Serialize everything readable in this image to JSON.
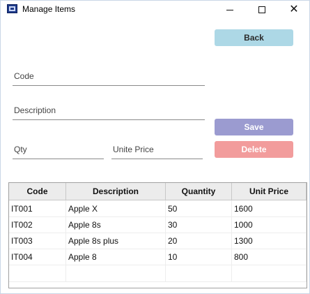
{
  "window": {
    "title": "Manage Items",
    "app_icon": "app-icon",
    "controls": {
      "minimize": "minimize-icon",
      "maximize": "maximize-icon",
      "close": "✕"
    }
  },
  "buttons": {
    "back": "Back",
    "save": "Save",
    "delete": "Delete"
  },
  "form": {
    "code_label": "Code",
    "description_label": "Description",
    "qty_label": "Qty",
    "unit_price_label": "Unite Price"
  },
  "colors": {
    "back_button": "#add8e6",
    "save_button": "#9b9bd0",
    "delete_button": "#f29c9c"
  },
  "table": {
    "columns": [
      "Code",
      "Description",
      "Quantity",
      "Unit Price"
    ],
    "rows": [
      [
        "IT001",
        "Apple X",
        "50",
        "1600"
      ],
      [
        "IT002",
        "Apple 8s",
        "30",
        "1000"
      ],
      [
        "IT003",
        "Apple 8s plus",
        "20",
        "1300"
      ],
      [
        "IT004",
        "Apple 8",
        "10",
        "800"
      ],
      [
        "",
        "",
        "",
        ""
      ]
    ]
  }
}
